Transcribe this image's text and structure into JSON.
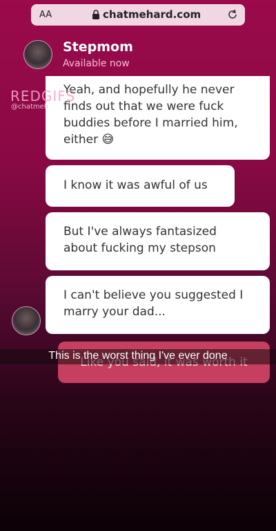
{
  "browser": {
    "text_size_label": "AA",
    "url": "chatmehard.com",
    "lock_icon": "lock-icon",
    "reload_icon": "reload-icon"
  },
  "header": {
    "title": "Stepmom",
    "status": "Available now"
  },
  "watermark": {
    "brand": "REDGIFS",
    "handle": "@chatmeh"
  },
  "messages": [
    {
      "text": "Yeah, and hopefully he never finds out that we were fuck buddies before I married him, either 😅"
    },
    {
      "text": "I know it was awful of us"
    },
    {
      "text": "But I've always fantasized about fucking my stepson"
    },
    {
      "text": "I can't believe you suggested I marry your dad..."
    },
    {
      "text": "Like you said, it was worth it"
    }
  ],
  "caption": "This is the worst thing I've ever done"
}
